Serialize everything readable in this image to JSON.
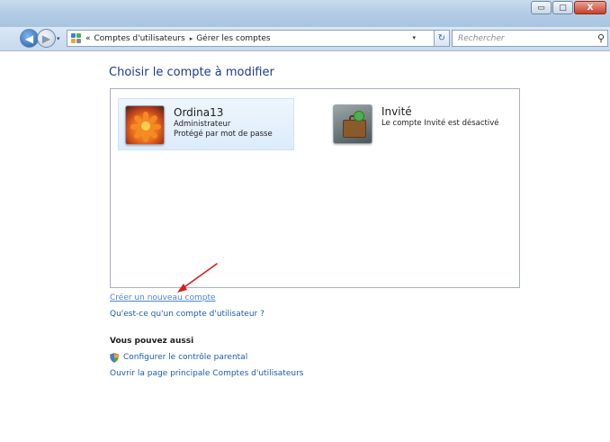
{
  "window": {
    "minimize_glyph": "▭",
    "maximize_glyph": "□",
    "close_glyph": "X"
  },
  "navigation": {
    "back_glyph": "◀",
    "forward_glyph": "▶",
    "breadcrumb_prefix": "«",
    "breadcrumbs": [
      "Comptes d'utilisateurs",
      "Gérer les comptes"
    ],
    "separator_glyph": "▸",
    "dropdown_glyph": "▾",
    "refresh_glyph": "↻",
    "search_placeholder": "Rechercher",
    "search_glyph": "⚲"
  },
  "main": {
    "title": "Choisir le compte à modifier",
    "accounts": [
      {
        "name": "Ordina13",
        "details": [
          "Administrateur",
          "Protégé par mot de passe"
        ],
        "icon": "flower-avatar-icon",
        "selected": true
      },
      {
        "name": "Invité",
        "details": [
          "Le compte Invité est désactivé"
        ],
        "icon": "guest-suitcase-icon",
        "selected": false
      }
    ],
    "links": {
      "create_account": "Créer un nouveau compte",
      "what_is_account": "Qu'est-ce qu'un compte d'utilisateur ?"
    },
    "see_also": {
      "title": "Vous pouvez aussi",
      "parental_control": "Configurer le contrôle parental",
      "main_page": "Ouvrir la page principale Comptes d'utilisateurs"
    }
  },
  "colors": {
    "link": "#1e5cb3",
    "title": "#1e3b8a",
    "annotation_arrow": "#d42020",
    "selection": "#dcecfb"
  }
}
